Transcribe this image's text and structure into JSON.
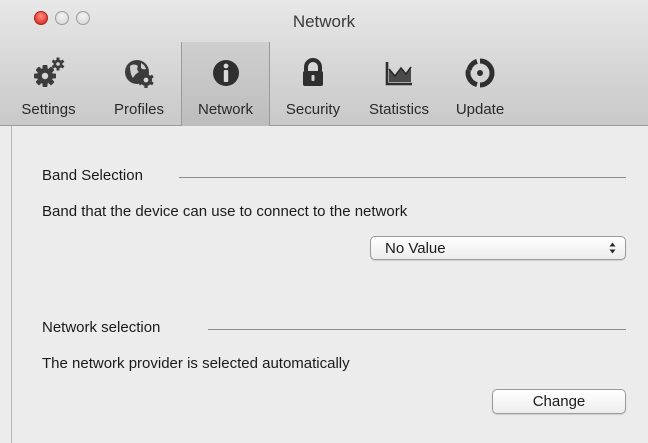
{
  "window": {
    "title": "Network"
  },
  "toolbar": {
    "tabs": [
      {
        "label": "Settings",
        "icon": "gears-icon"
      },
      {
        "label": "Profiles",
        "icon": "globe-gear-icon"
      },
      {
        "label": "Network",
        "icon": "info-icon",
        "selected": true
      },
      {
        "label": "Security",
        "icon": "lock-icon"
      },
      {
        "label": "Statistics",
        "icon": "chart-icon"
      },
      {
        "label": "Update",
        "icon": "update-icon"
      }
    ]
  },
  "band_section": {
    "title": "Band Selection",
    "description": "Band that the device can use to connect to the network",
    "select_value": "No Value"
  },
  "network_section": {
    "title": "Network selection",
    "description": "The network provider is selected automatically",
    "button_label": "Change"
  },
  "colors": {
    "close_button": "#ec4c43",
    "window_background": "#ececec",
    "active_tab": "#c4c4c4"
  }
}
